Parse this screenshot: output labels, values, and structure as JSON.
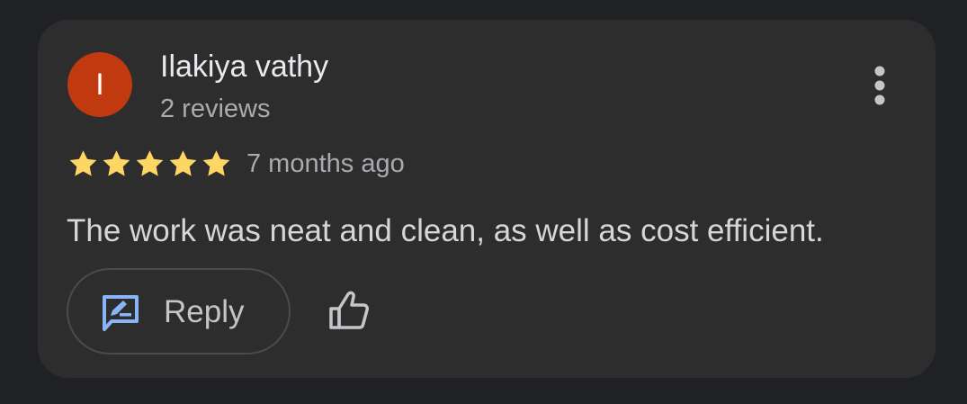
{
  "review": {
    "avatar_initial": "I",
    "reviewer_name": "Ilakiya vathy",
    "review_count": "2 reviews",
    "rating": 5,
    "rating_max": 5,
    "time_ago": "7 months ago",
    "text": "The work was neat and clean, as well as cost efficient."
  },
  "actions": {
    "reply_label": "Reply",
    "reply_icon": "edit-message-icon",
    "like_icon": "thumb-up-icon",
    "more_icon": "more-vert-icon"
  },
  "colors": {
    "background": "#202124",
    "card": "#2d2d2e",
    "avatar": "#c0390f",
    "star": "#fdd663",
    "accent": "#8ab4f8"
  }
}
